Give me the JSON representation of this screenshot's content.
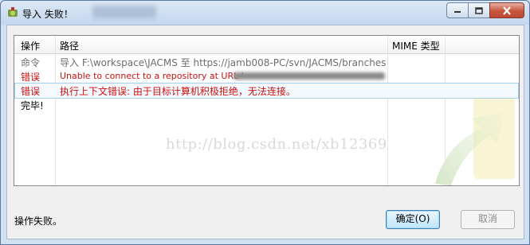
{
  "window": {
    "title": "导入 失败！",
    "buttons": {
      "minimize": "minimize",
      "maximize": "maximize",
      "close": "close"
    }
  },
  "table": {
    "headers": {
      "action": "操作",
      "path": "路径",
      "mime": "MIME 类型"
    },
    "rows": [
      {
        "action": "命令",
        "path": "导入 F:\\workspace\\JACMS 至 https://jamb008-PC/svn/JACMS/branches",
        "style": "gray"
      },
      {
        "action": "错误",
        "path": "Unable to connect to a repository at URL '",
        "style": "red"
      },
      {
        "action": "错误",
        "path": "执行上下文错误: 由于目标计算机积极拒绝，无法连接。",
        "style": "red"
      },
      {
        "action": "完毕!",
        "path": "",
        "style": "black"
      }
    ]
  },
  "watermark": "http://blog.csdn.net/xb12369",
  "status_text": "操作失败。",
  "buttons": {
    "ok": "确定(O)",
    "cancel": "取消"
  },
  "colors": {
    "error": "#cc1111",
    "command": "#6d6d6d",
    "selection": "#a6d0ee"
  }
}
